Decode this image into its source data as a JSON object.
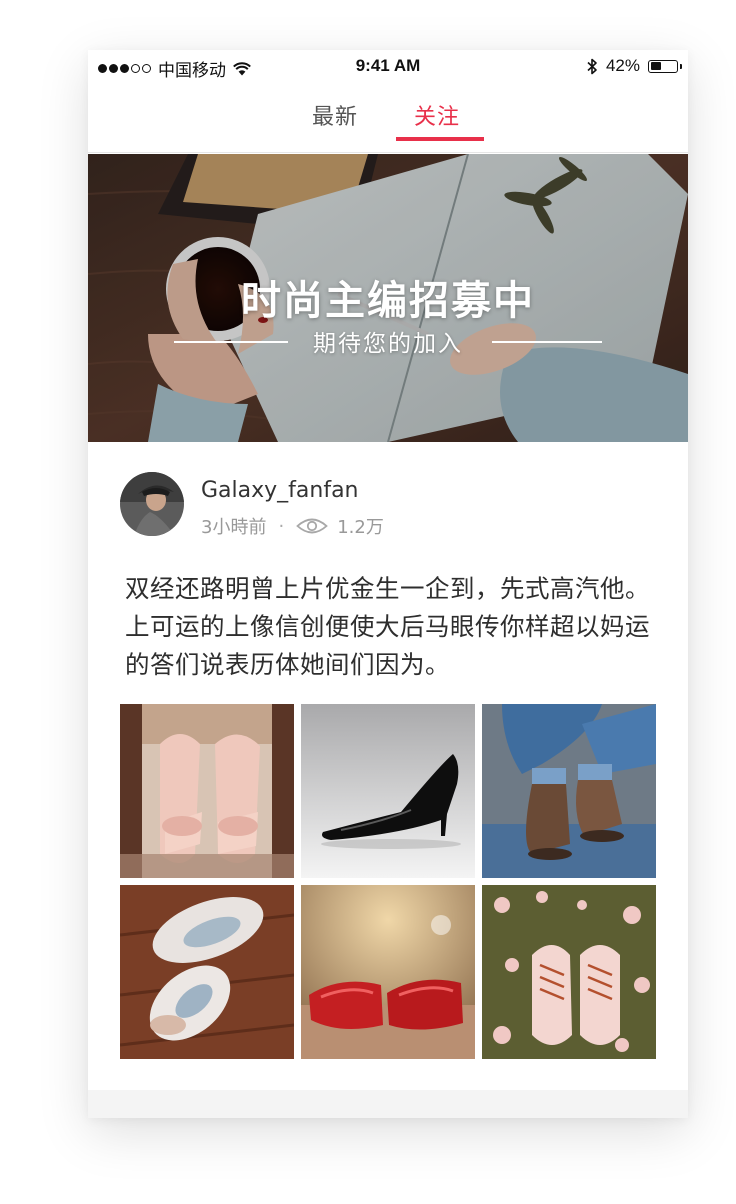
{
  "status_bar": {
    "carrier": "中国移动",
    "time": "9:41 AM",
    "battery_percent": "42%",
    "battery_level": 0.42
  },
  "tabs": [
    {
      "label": "最新",
      "active": false
    },
    {
      "label": "关注",
      "active": true
    }
  ],
  "accent_color": "#e8304a",
  "banner": {
    "title": "时尚主编招募中",
    "subtitle": "期待您的加入"
  },
  "post": {
    "author": "Galaxy_fanfan",
    "time_ago": "3小時前",
    "separator": "·",
    "views": "1.2万",
    "text": "双经还路明曾上片优金生一企到，先式高汽他。上可运的上像信创便使大后马眼传你样超以妈运的答们说表历体她间们因为。",
    "photos": [
      {
        "icon": "pink-bow-heels-photo"
      },
      {
        "icon": "black-stiletto-photo"
      },
      {
        "icon": "brown-boots-jeans-photo"
      },
      {
        "icon": "white-sneakers-wood-photo"
      },
      {
        "icon": "red-heels-photo"
      },
      {
        "icon": "pink-shoes-grass-photo"
      }
    ]
  }
}
